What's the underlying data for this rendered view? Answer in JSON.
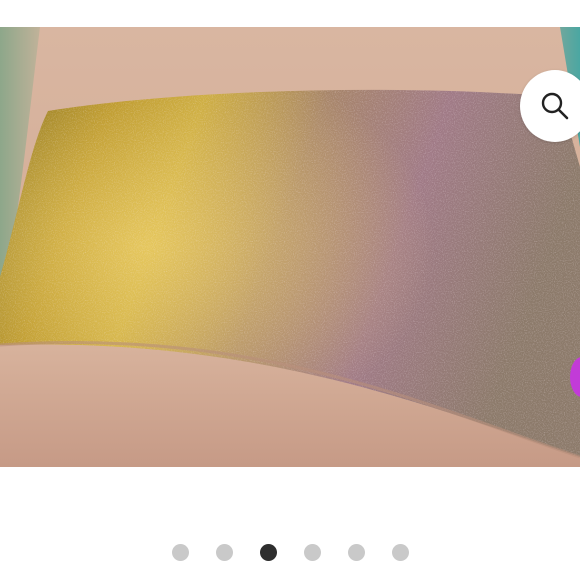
{
  "gallery": {
    "photo_alt": "Swatch photo",
    "slide_count": 6,
    "active_index": 2
  },
  "zoom": {
    "icon": "magnifier-icon"
  },
  "colors": {
    "active_dot": "#2e2e2e",
    "inactive_dot": "#c9c9c9",
    "accent_peek": "#c23bd8"
  }
}
